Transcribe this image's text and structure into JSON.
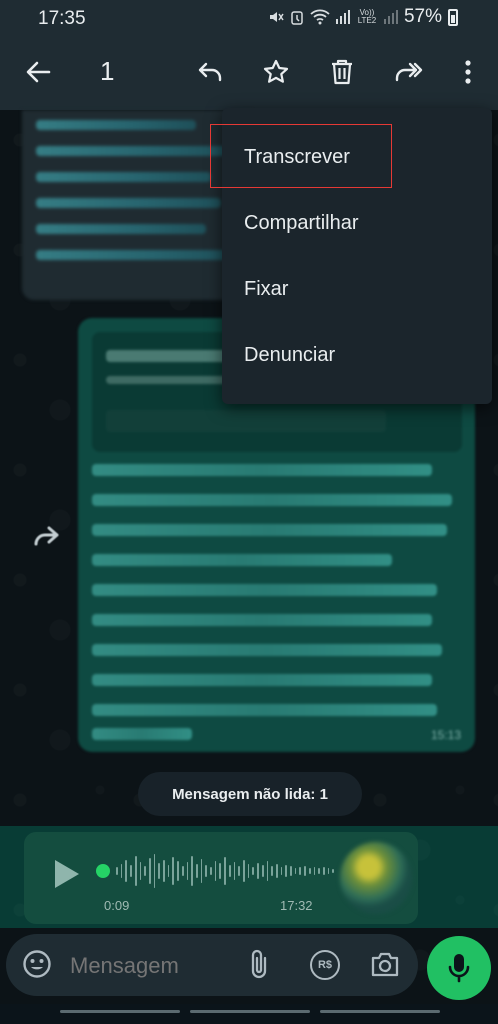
{
  "status_bar": {
    "time": "17:35",
    "network_label": "Vo)) LTE2",
    "battery": "57%"
  },
  "toolbar": {
    "selected_count": "1",
    "icons": [
      "back-arrow-icon",
      "reply-icon",
      "star-icon",
      "delete-icon",
      "forward-icon",
      "more-options-icon"
    ]
  },
  "messages": {
    "outgoing_link_time": "15:13",
    "unread_banner": "Mensagem não lida: 1",
    "audio": {
      "duration": "0:09",
      "time": "17:32"
    }
  },
  "menu": {
    "items": [
      {
        "label": "Transcrever",
        "highlighted": true
      },
      {
        "label": "Compartilhar"
      },
      {
        "label": "Fixar"
      },
      {
        "label": "Denunciar"
      }
    ]
  },
  "input_bar": {
    "placeholder": "Mensagem",
    "payment_label": "R$"
  },
  "colors": {
    "accent_green": "#21c063",
    "highlight_box": "#e53935",
    "toolbar_bg": "#1f2c33"
  }
}
